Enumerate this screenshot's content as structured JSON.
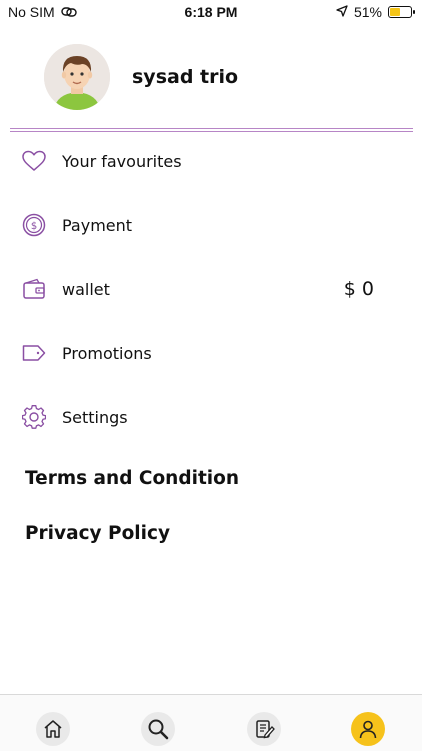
{
  "status_bar": {
    "carrier": "No SIM",
    "time": "6:18 PM",
    "battery_percent": "51%",
    "battery_level": 0.51,
    "battery_color": "#f5c518"
  },
  "profile": {
    "name": "sysad trio",
    "avatar_icon": "user-avatar"
  },
  "menu": {
    "items": [
      {
        "label": "Your favourites",
        "icon": "heart-icon"
      },
      {
        "label": "Payment",
        "icon": "dollar-coin-icon"
      },
      {
        "label": "wallet",
        "icon": "wallet-icon",
        "value": "$ 0"
      },
      {
        "label": "Promotions",
        "icon": "tag-icon"
      },
      {
        "label": "Settings",
        "icon": "gear-icon"
      }
    ]
  },
  "links": {
    "terms": "Terms and Condition",
    "privacy": "Privacy Policy"
  },
  "bottom_nav": {
    "items": [
      {
        "icon": "home-icon"
      },
      {
        "icon": "search-icon"
      },
      {
        "icon": "orders-icon"
      },
      {
        "icon": "profile-icon",
        "active": true
      }
    ],
    "active_color": "#f6c21b"
  },
  "colors": {
    "accent_purple": "#8a4fa3",
    "divider": "#b785c6"
  }
}
